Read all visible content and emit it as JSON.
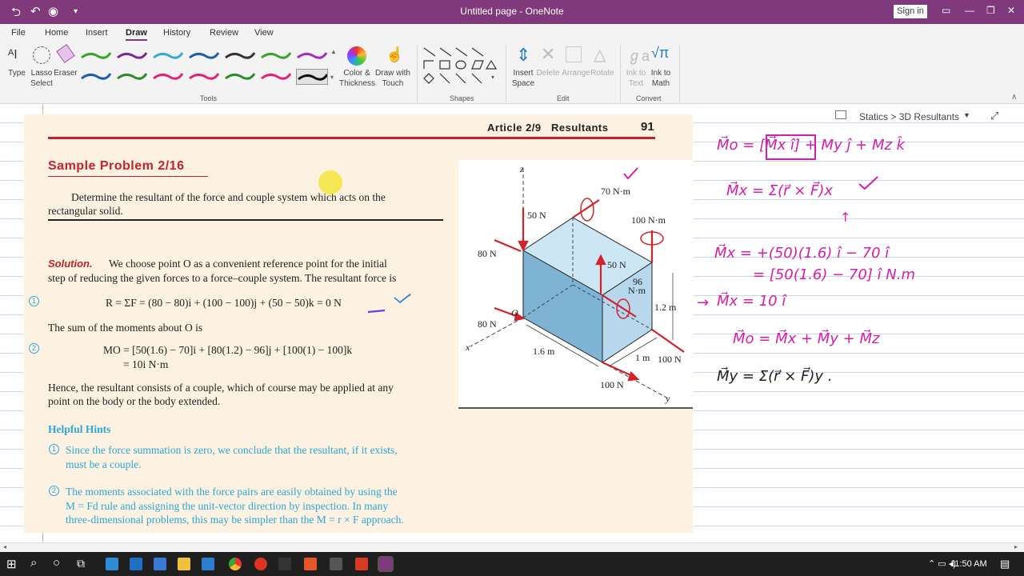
{
  "titlebar": {
    "title": "Untitled page - OneNote",
    "signin": "Sign in"
  },
  "menu": [
    "File",
    "Home",
    "Insert",
    "Draw",
    "History",
    "Review",
    "View"
  ],
  "menu_active": "Draw",
  "ribbon": {
    "type": "Type",
    "lasso": [
      "Lasso",
      "Select"
    ],
    "eraser": "Eraser",
    "color_thickness": [
      "Color &",
      "Thickness"
    ],
    "draw_touch": [
      "Draw with",
      "Touch"
    ],
    "insert_space": [
      "Insert",
      "Space"
    ],
    "delete": "Delete",
    "arrange": "Arrange",
    "rotate": "Rotate",
    "ink_text": [
      "Ink to",
      "Text"
    ],
    "ink_math": [
      "Ink to",
      "Math"
    ],
    "groups": {
      "tools": "Tools",
      "shapes": "Shapes",
      "edit": "Edit",
      "convert": "Convert"
    },
    "pen_colors": [
      "#3aa52a",
      "#7a2b8e",
      "#3aa8d4",
      "#1f5fa8",
      "#333333",
      "#3aa52a",
      "#a02fbf",
      "#1f5fa8",
      "#2d8a2d",
      "#e0247a",
      "#e0247a",
      "#2d8a2d",
      "#e0247a",
      "#111111"
    ]
  },
  "breadcrumb": "Statics > 3D Resultants",
  "book": {
    "article": "Article 2/9   Resultants",
    "page_number": "91",
    "title": "Sample Problem 2/16",
    "problem_l1": "Determine the resultant of the force and couple system which acts on the",
    "problem_l2": "rectangular solid.",
    "solution_label": "Solution.",
    "solution_l1": "We choose point O as a convenient reference point for the initial",
    "solution_l2": "step of reducing the given forces to a force–couple system. The resultant force is",
    "eq1": "R = ΣF = (80 − 80)i + (100 − 100)j + (50 − 50)k = 0 N",
    "moments_line": "The sum of the moments about O is",
    "eq2a": "MO = [50(1.6) − 70]i + [80(1.2) − 96]j + [100(1) − 100]k",
    "eq2b": "= 10i N·m",
    "hence_l1": "Hence, the resultant consists of a couple, which of course may be applied at any",
    "hence_l2": "point on the body or the body extended.",
    "hints_title": "Helpful Hints",
    "hint1_l1": "Since the force summation is zero, we conclude that the resultant, if it exists,",
    "hint1_l2": "must be a couple.",
    "hint2_l1": "The moments associated with the force pairs are easily obtained by using the",
    "hint2_l2": "M = Fd rule and assigning the unit-vector direction by inspection. In many",
    "hint2_l3": "three-dimensional problems, this may be simpler than the M = r × F approach.",
    "circle1": "1",
    "circle2": "2"
  },
  "figure": {
    "z": "z",
    "x": "x",
    "y": "y",
    "o": "O",
    "f50a": "50 N",
    "f80a": "80 N",
    "f70": "70 N·m",
    "f100m": "100 N·m",
    "f50b": "50 N",
    "f96a": "96",
    "f96b": "N·m",
    "f80b": "80 N",
    "d12": "1.2 m",
    "d16": "1.6 m",
    "d1": "1 m",
    "f100a": "100 N",
    "f100b": "100 N"
  },
  "ink": {
    "l1": "M⃗o = [M⃗x î] + My ĵ + Mz k̂",
    "l2": "M⃗x = Σ(r⃗ × F⃗)x",
    "l3": "M⃗x = +(50)(1.6) î − 70 î",
    "l4": "= [50(1.6) − 70] î   N.m",
    "l5": "M⃗x =  10 î",
    "l6": "M⃗o = M⃗x + M⃗y + M⃗z",
    "l7": "M⃗y = Σ(r⃗ × F⃗)y ."
  },
  "taskbar": {
    "time": "11:50 AM"
  }
}
